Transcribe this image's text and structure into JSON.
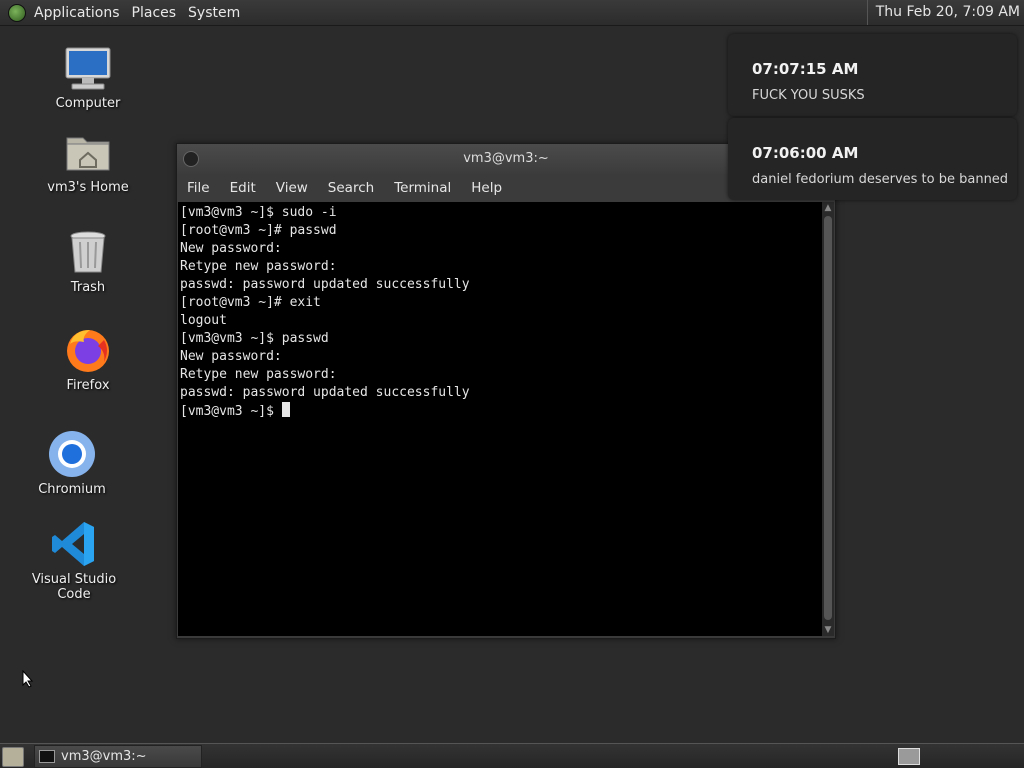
{
  "top_panel": {
    "menus": [
      "Applications",
      "Places",
      "System"
    ],
    "clock": "Thu Feb 20,  7:09 AM"
  },
  "desktop_icons": [
    {
      "label": "Computer",
      "icon": "computer-icon"
    },
    {
      "label": "vm3's Home",
      "icon": "home-folder-icon"
    },
    {
      "label": "Trash",
      "icon": "trash-icon"
    },
    {
      "label": "Firefox",
      "icon": "firefox-icon"
    },
    {
      "label": "Chromium",
      "icon": "chromium-icon"
    },
    {
      "label": "Visual Studio Code",
      "icon": "vscode-icon"
    }
  ],
  "terminal": {
    "title": "vm3@vm3:~",
    "menu": [
      "File",
      "Edit",
      "View",
      "Search",
      "Terminal",
      "Help"
    ],
    "lines": [
      "[vm3@vm3 ~]$ sudo -i",
      "[root@vm3 ~]# passwd",
      "New password:",
      "Retype new password:",
      "passwd: password updated successfully",
      "[root@vm3 ~]# exit",
      "logout",
      "[vm3@vm3 ~]$ passwd",
      "New password:",
      "Retype new password:",
      "passwd: password updated successfully"
    ],
    "prompt": "[vm3@vm3 ~]$ "
  },
  "notifications": [
    {
      "time": "07:07:15 AM",
      "message": "FUCK YOU SUSKS"
    },
    {
      "time": "07:06:00 AM",
      "message": "daniel fedorium deserves to be banned"
    }
  ],
  "taskbar": {
    "task_label": "vm3@vm3:~"
  },
  "colors": {
    "desktop_bg": "#2b2b2b",
    "terminal_bg": "#000000",
    "terminal_fg": "#e6e6e6"
  }
}
